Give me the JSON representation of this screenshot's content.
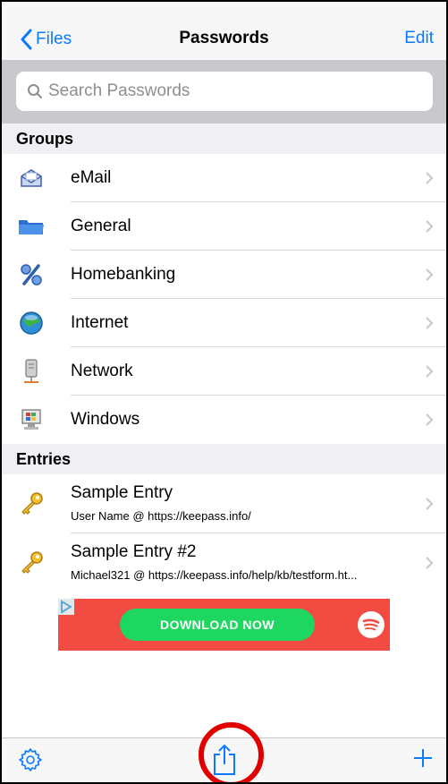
{
  "nav": {
    "back_label": "Files",
    "title": "Passwords",
    "edit_label": "Edit"
  },
  "search": {
    "placeholder": "Search Passwords",
    "value": ""
  },
  "groups": {
    "header": "Groups",
    "items": [
      {
        "label": "eMail",
        "icon": "email-envelope-icon"
      },
      {
        "label": "General",
        "icon": "folder-icon"
      },
      {
        "label": "Homebanking",
        "icon": "percent-icon"
      },
      {
        "label": "Internet",
        "icon": "globe-icon"
      },
      {
        "label": "Network",
        "icon": "network-server-icon"
      },
      {
        "label": "Windows",
        "icon": "windows-computer-icon"
      }
    ]
  },
  "entries": {
    "header": "Entries",
    "items": [
      {
        "title": "Sample Entry",
        "subtitle": "User Name @ https://keepass.info/",
        "icon": "key-icon"
      },
      {
        "title": "Sample Entry #2",
        "subtitle": "Michael321 @ https://keepass.info/help/kb/testform.ht...",
        "icon": "key-icon"
      }
    ]
  },
  "ad": {
    "button_label": "DOWNLOAD NOW",
    "brand_icon": "spotify-icon"
  },
  "toolbar": {
    "settings_icon": "gear-icon",
    "share_icon": "share-icon",
    "add_icon": "plus-icon"
  },
  "colors": {
    "accent": "#0a7aff",
    "ad_background": "#f24c42",
    "ad_button": "#1ed760",
    "highlight_circle": "#e00000"
  }
}
